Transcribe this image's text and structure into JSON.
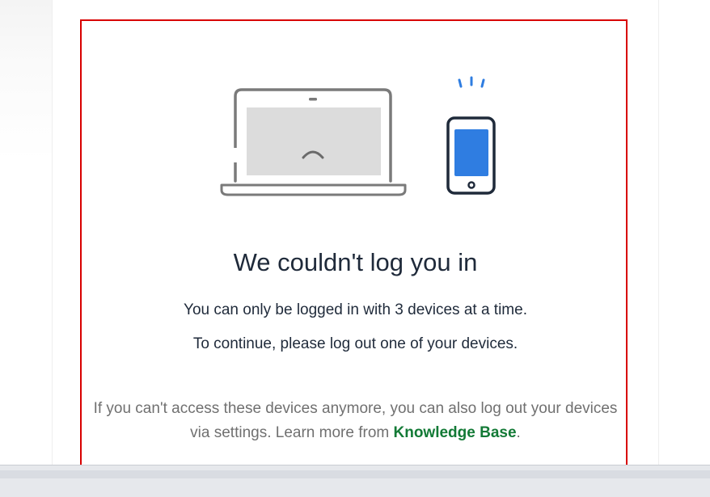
{
  "dialog": {
    "title": "We couldn't log you in",
    "message_line1": "You can only be logged in with 3 devices at a time.",
    "message_line2": "To continue, please log out one of your devices.",
    "help_text": "If you can't access these devices anymore, you can also log out your devices via settings. Learn more from",
    "help_link": "Knowledge Base",
    "help_suffix": "."
  },
  "illustration": {
    "icons": [
      "laptop-sad-icon",
      "phone-vibrating-icon"
    ]
  },
  "colors": {
    "panel_border": "#d80000",
    "title_text": "#1f2a3a",
    "help_text": "#707070",
    "link": "#137a36",
    "phone_screen": "#2f7de1",
    "laptop_outline": "#7a7a7a",
    "laptop_screen": "#dcdcdc"
  }
}
